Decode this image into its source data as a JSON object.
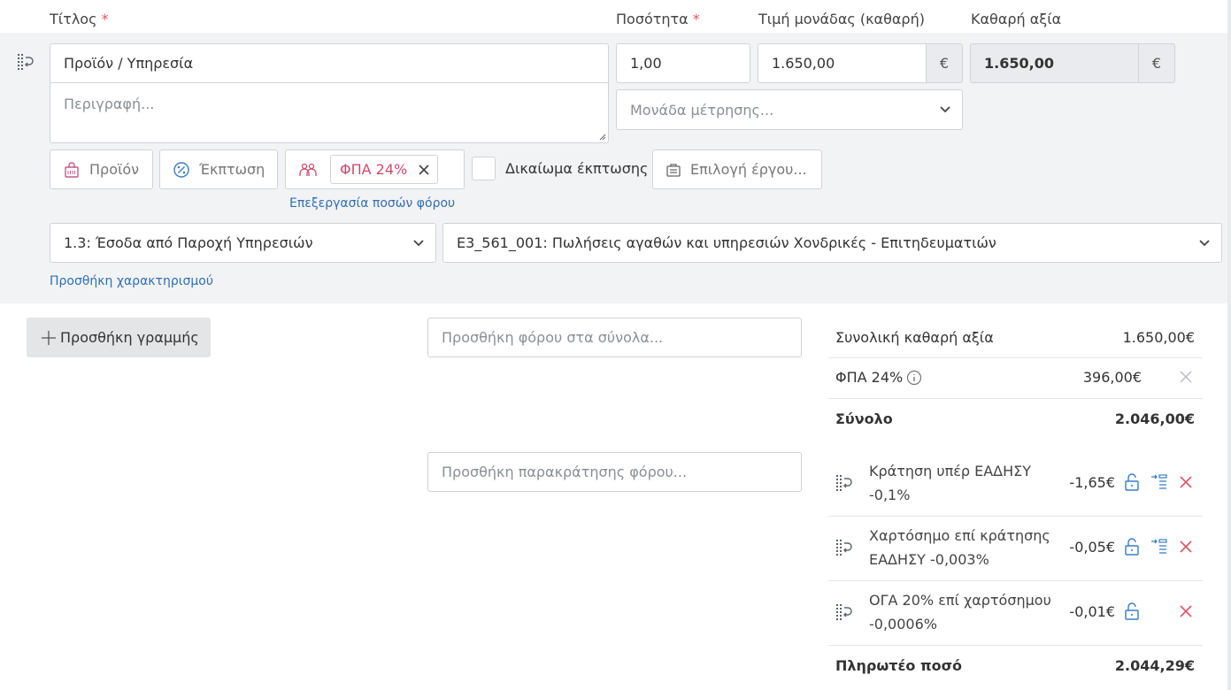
{
  "header": {
    "title_label": "Τίτλος",
    "quantity_label": "Ποσότητα",
    "unit_price_label": "Τιμή μονάδας (καθαρή)",
    "net_value_label": "Καθαρή αξία",
    "required_mark": "*"
  },
  "line": {
    "title_value": "Προϊόν / Υπηρεσία",
    "description_placeholder": "Περιγραφή...",
    "quantity_value": "1,00",
    "unit_price_value": "1.650,00",
    "currency": "€",
    "net_value": "1.650,00",
    "unit_placeholder": "Μονάδα μέτρησης...",
    "product_button": "Προϊόν",
    "discount_button": "Έκπτωση",
    "vat_tag": "ΦΠΑ 24%",
    "deduction_right_label": "Δικαίωμα έκπτωσης",
    "project_button": "Επιλογή έργου...",
    "edit_tax_link": "Επεξεργασία ποσών φόρου",
    "income_category": "1.3: Έσοδα από Παροχή Υπηρεσιών",
    "income_type": "E3_561_001: Πωλήσεις αγαθών και υπηρεσιών Χονδρικές - Επιτηδευματιών",
    "add_classification_link": "Προσθήκη χαρακτηρισμού"
  },
  "actions": {
    "add_line_button": "Προσθήκη γραμμής",
    "add_tax_placeholder": "Προσθήκη φόρου στα σύνολα...",
    "add_withholding_placeholder": "Προσθήκη παρακράτησης φόρου..."
  },
  "summary": {
    "net_total_label": "Συνολική καθαρή αξία",
    "net_total_value": "1.650,00€",
    "vat_label": "ΦΠΑ 24%",
    "vat_value": "396,00€",
    "total_label": "Σύνολο",
    "total_value": "2.046,00€",
    "withholdings": [
      {
        "line1": "Κράτηση υπέρ ΕΑΔΗΣΥ",
        "line2": "-0,1%",
        "value": "-1,65€",
        "has_move": true
      },
      {
        "line1": "Χαρτόσημο επί κράτησης",
        "line2": "ΕΑΔΗΣΥ -0,003%",
        "value": "-0,05€",
        "has_move": true
      },
      {
        "line1": "ΟΓΑ 20% επί χαρτόσημου",
        "line2": "-0,0006%",
        "value": "-0,01€",
        "has_move": false
      }
    ],
    "payable_label": "Πληρωτέο ποσό",
    "payable_value": "2.044,29€"
  },
  "colors": {
    "panel_bg": "#f2f3f5",
    "link": "#2f6fb3",
    "required": "#e05565",
    "vat_tag_text": "#d04a6a",
    "remove_red": "#e05565",
    "icon_blue": "#3a7bc8"
  },
  "icons": [
    "reorder-icon",
    "product-bag-icon",
    "discount-icon",
    "vat-people-icon",
    "close-icon",
    "project-briefcase-icon",
    "chevron-down-icon",
    "info-icon",
    "plus-icon",
    "unlock-icon",
    "move-to-line-icon"
  ]
}
